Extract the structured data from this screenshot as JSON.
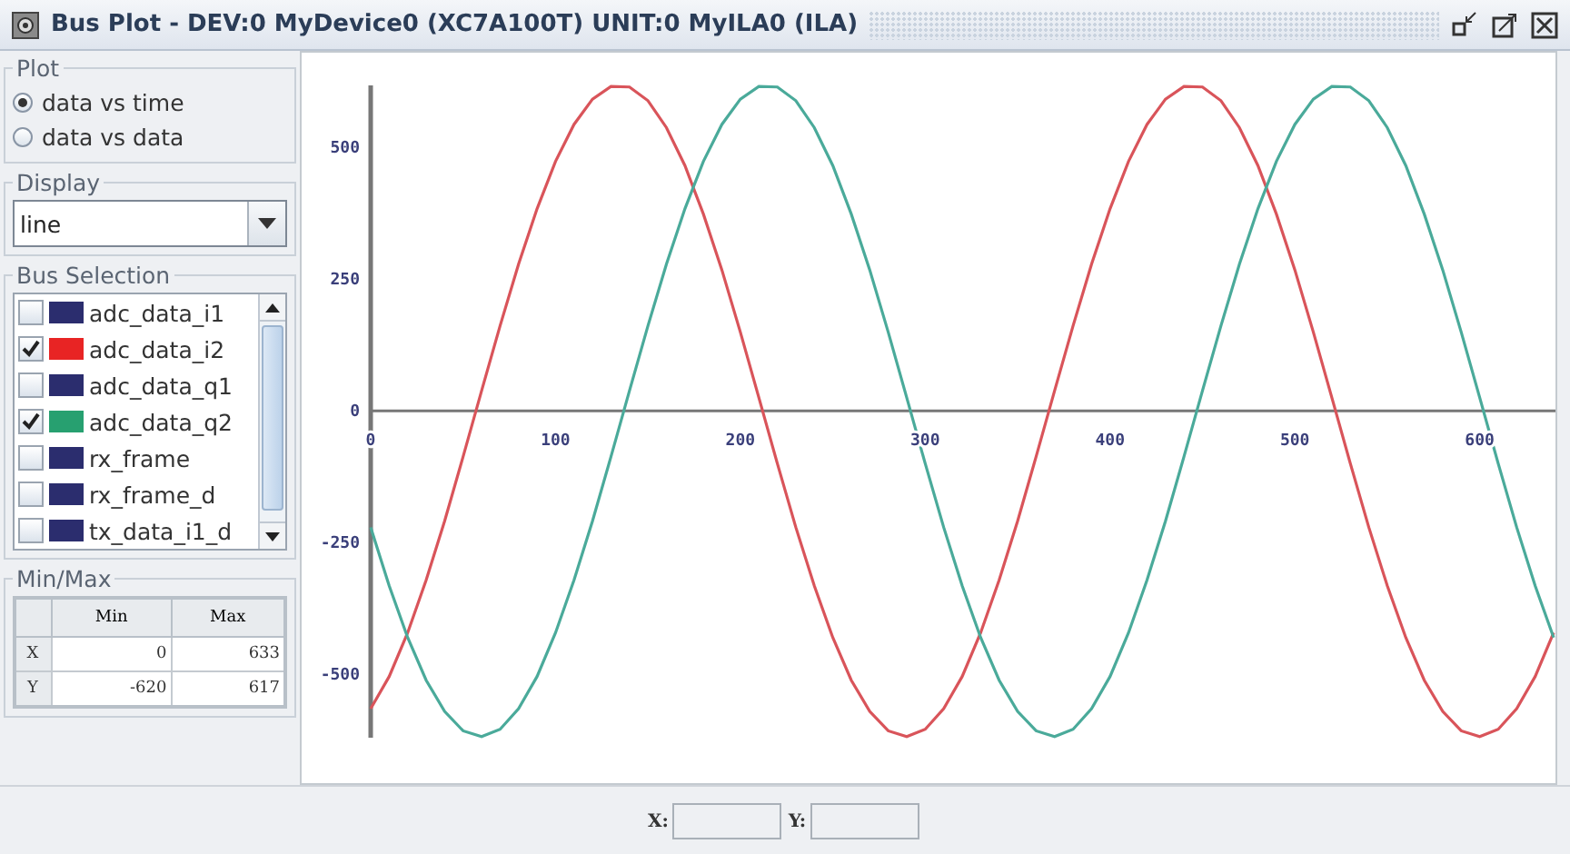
{
  "window": {
    "title": "Bus Plot - DEV:0 MyDevice0 (XC7A100T) UNIT:0 MyILA0 (ILA)"
  },
  "plot_group": {
    "title": "Plot",
    "options": [
      {
        "label": "data vs time",
        "selected": true
      },
      {
        "label": "data vs data",
        "selected": false
      }
    ]
  },
  "display_group": {
    "title": "Display",
    "value": "line"
  },
  "bus_selection": {
    "title": "Bus Selection",
    "items": [
      {
        "name": "adc_data_i1",
        "checked": false,
        "color": "#2b2d6e"
      },
      {
        "name": "adc_data_i2",
        "checked": true,
        "color": "#e82424"
      },
      {
        "name": "adc_data_q1",
        "checked": false,
        "color": "#2b2d6e"
      },
      {
        "name": "adc_data_q2",
        "checked": true,
        "color": "#27a070"
      },
      {
        "name": "rx_frame",
        "checked": false,
        "color": "#2b2d6e"
      },
      {
        "name": "rx_frame_d",
        "checked": false,
        "color": "#2b2d6e"
      },
      {
        "name": "tx_data_i1_d",
        "checked": false,
        "color": "#2b2d6e"
      }
    ]
  },
  "minmax": {
    "title": "Min/Max",
    "columns": [
      "Min",
      "Max"
    ],
    "rows": [
      {
        "label": "X",
        "min": "0",
        "max": "633"
      },
      {
        "label": "Y",
        "min": "-620",
        "max": "617"
      }
    ]
  },
  "chart_data": {
    "type": "line",
    "xlim": [
      0,
      640
    ],
    "ylim": [
      -620,
      617
    ],
    "xticks": [
      0,
      100,
      200,
      300,
      400,
      500,
      600
    ],
    "yticks": [
      -500,
      -250,
      0,
      250,
      500
    ],
    "x": [
      0,
      10,
      20,
      30,
      40,
      50,
      60,
      70,
      80,
      90,
      100,
      110,
      120,
      130,
      140,
      150,
      160,
      170,
      180,
      190,
      200,
      210,
      220,
      230,
      240,
      250,
      260,
      270,
      280,
      290,
      300,
      310,
      320,
      330,
      340,
      350,
      360,
      370,
      380,
      390,
      400,
      410,
      420,
      430,
      440,
      450,
      460,
      470,
      480,
      490,
      500,
      510,
      520,
      530,
      540,
      550,
      560,
      570,
      580,
      590,
      600,
      610,
      620,
      630,
      640
    ],
    "series": [
      {
        "color": "#d9545a",
        "values": [
          -565,
          -504,
          -421,
          -321,
          -209,
          -87,
          38,
          161,
          278,
          383,
          473,
          543,
          591,
          615,
          614,
          588,
          537,
          465,
          373,
          267,
          149,
          25,
          -100,
          -221,
          -332,
          -430,
          -511,
          -570,
          -607,
          -618,
          -604,
          -565,
          -504,
          -421,
          -321,
          -209,
          -87,
          38,
          161,
          278,
          383,
          473,
          543,
          591,
          615,
          614,
          588,
          537,
          465,
          373,
          267,
          149,
          25,
          -100,
          -221,
          -332,
          -430,
          -511,
          -570,
          -607,
          -618,
          -604,
          -565,
          -504,
          -421
        ]
      },
      {
        "color": "#4aaa9a",
        "values": [
          -221,
          -332,
          -430,
          -511,
          -570,
          -607,
          -618,
          -604,
          -565,
          -504,
          -421,
          -321,
          -209,
          -87,
          38,
          161,
          278,
          383,
          473,
          543,
          591,
          615,
          614,
          588,
          537,
          465,
          373,
          267,
          149,
          25,
          -100,
          -221,
          -332,
          -430,
          -511,
          -570,
          -607,
          -618,
          -604,
          -565,
          -504,
          -421,
          -321,
          -209,
          -87,
          38,
          161,
          278,
          383,
          473,
          543,
          591,
          615,
          614,
          588,
          537,
          465,
          373,
          267,
          149,
          25,
          -100,
          -221,
          -332,
          -430
        ]
      }
    ]
  },
  "status_bar": {
    "x_label": "X:",
    "y_label": "Y:"
  }
}
